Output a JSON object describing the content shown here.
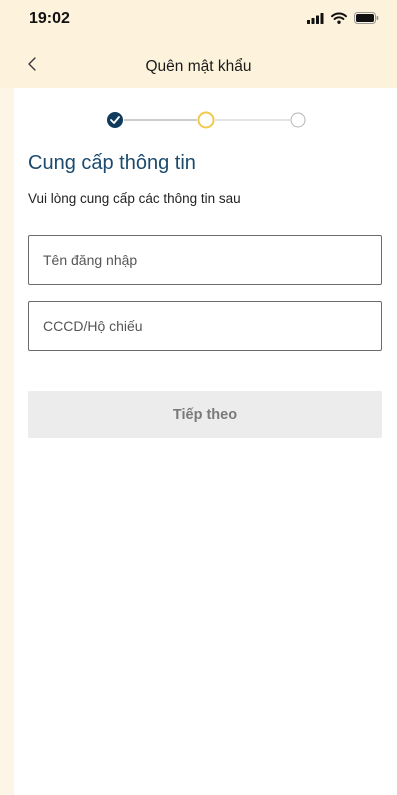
{
  "status_bar": {
    "time": "19:02",
    "icons": [
      "cellular-signal-icon",
      "wifi-icon",
      "battery-icon"
    ]
  },
  "header": {
    "back_icon": "chevron-left-icon",
    "title": "Quên mật khẩu"
  },
  "stepper": {
    "steps": [
      "completed",
      "current",
      "upcoming"
    ],
    "colors": {
      "completed": "#0f3a5c",
      "current": "#f2c94c",
      "upcoming": "#b5b5b5",
      "line": "#9a9a9a"
    }
  },
  "main": {
    "heading": "Cung cấp thông tin",
    "subheading": "Vui lòng cung cấp các thông tin sau",
    "username_placeholder": "Tên đăng nhập",
    "id_placeholder": "CCCD/Hộ chiếu",
    "next_label": "Tiếp theo"
  },
  "colors": {
    "background": "#fdf6e6",
    "header_background": "#fdf3dc",
    "heading": "#1b4a6e",
    "button_disabled": "#ececec"
  }
}
